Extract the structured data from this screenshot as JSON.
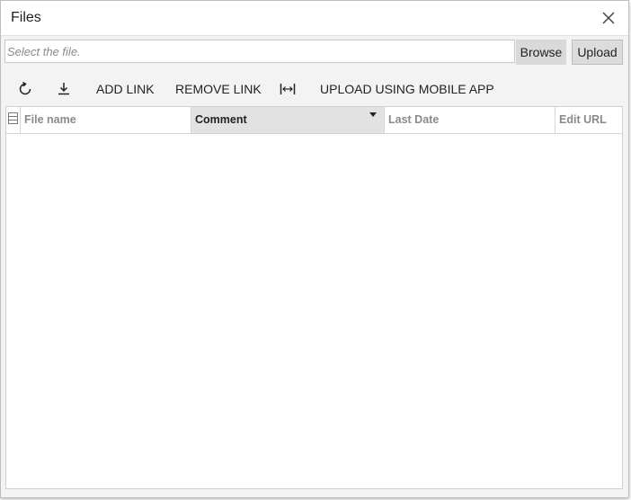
{
  "dialog": {
    "title": "Files"
  },
  "file_picker": {
    "placeholder": "Select the file.",
    "browse_label": "Browse",
    "upload_label": "Upload"
  },
  "toolbar": {
    "refresh_icon": "refresh-icon",
    "download_icon": "download-icon",
    "add_link_label": "ADD LINK",
    "remove_link_label": "REMOVE LINK",
    "fit_width_icon": "fit-width-icon",
    "upload_mobile_label": "UPLOAD USING MOBILE APP"
  },
  "grid": {
    "columns": [
      {
        "key": "file_name",
        "label": "File name"
      },
      {
        "key": "comment",
        "label": "Comment",
        "sorted": "desc"
      },
      {
        "key": "last_date",
        "label": "Last Date"
      },
      {
        "key": "edit_url",
        "label": "Edit URL"
      }
    ],
    "rows": []
  },
  "colors": {
    "active_column_bg": "#e2e2e2",
    "button_bg": "#d9d9d9",
    "panel_bg": "#f3f3f3"
  }
}
